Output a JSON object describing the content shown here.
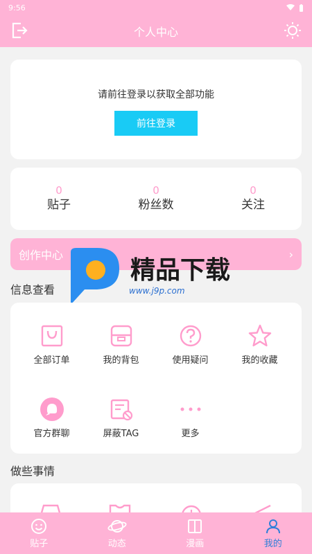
{
  "status": {
    "time": "9:56"
  },
  "header": {
    "title": "个人中心"
  },
  "login": {
    "hint": "请前往登录以获取全部功能",
    "button": "前往登录"
  },
  "stats": [
    {
      "value": "0",
      "label": "贴子"
    },
    {
      "value": "0",
      "label": "粉丝数"
    },
    {
      "value": "0",
      "label": "关注"
    }
  ],
  "creator": {
    "label": "创作中心",
    "chevron": "›"
  },
  "info": {
    "title": "信息查看",
    "items": [
      {
        "label": "全部订单",
        "icon": "shopping-bag-icon"
      },
      {
        "label": "我的背包",
        "icon": "backpack-icon"
      },
      {
        "label": "使用疑问",
        "icon": "question-icon"
      },
      {
        "label": "我的收藏",
        "icon": "star-icon"
      },
      {
        "label": "官方群聊",
        "icon": "chat-icon"
      },
      {
        "label": "屏蔽TAG",
        "icon": "block-tag-icon"
      },
      {
        "label": "更多",
        "icon": "more-icon"
      }
    ]
  },
  "do_things": {
    "title": "做些事情"
  },
  "watermark": {
    "brand": "精品下载",
    "url": "www.j9p.com"
  },
  "tabs": [
    {
      "label": "贴子",
      "icon": "smile-icon",
      "active": false
    },
    {
      "label": "动态",
      "icon": "planet-icon",
      "active": false
    },
    {
      "label": "漫画",
      "icon": "book-icon",
      "active": false
    },
    {
      "label": "我的",
      "icon": "person-icon",
      "active": true
    }
  ],
  "colors": {
    "pink": "#ffb3d6",
    "accent": "#19cbf5",
    "number": "#ff9ccc",
    "active_tab": "#2f7fd9"
  }
}
